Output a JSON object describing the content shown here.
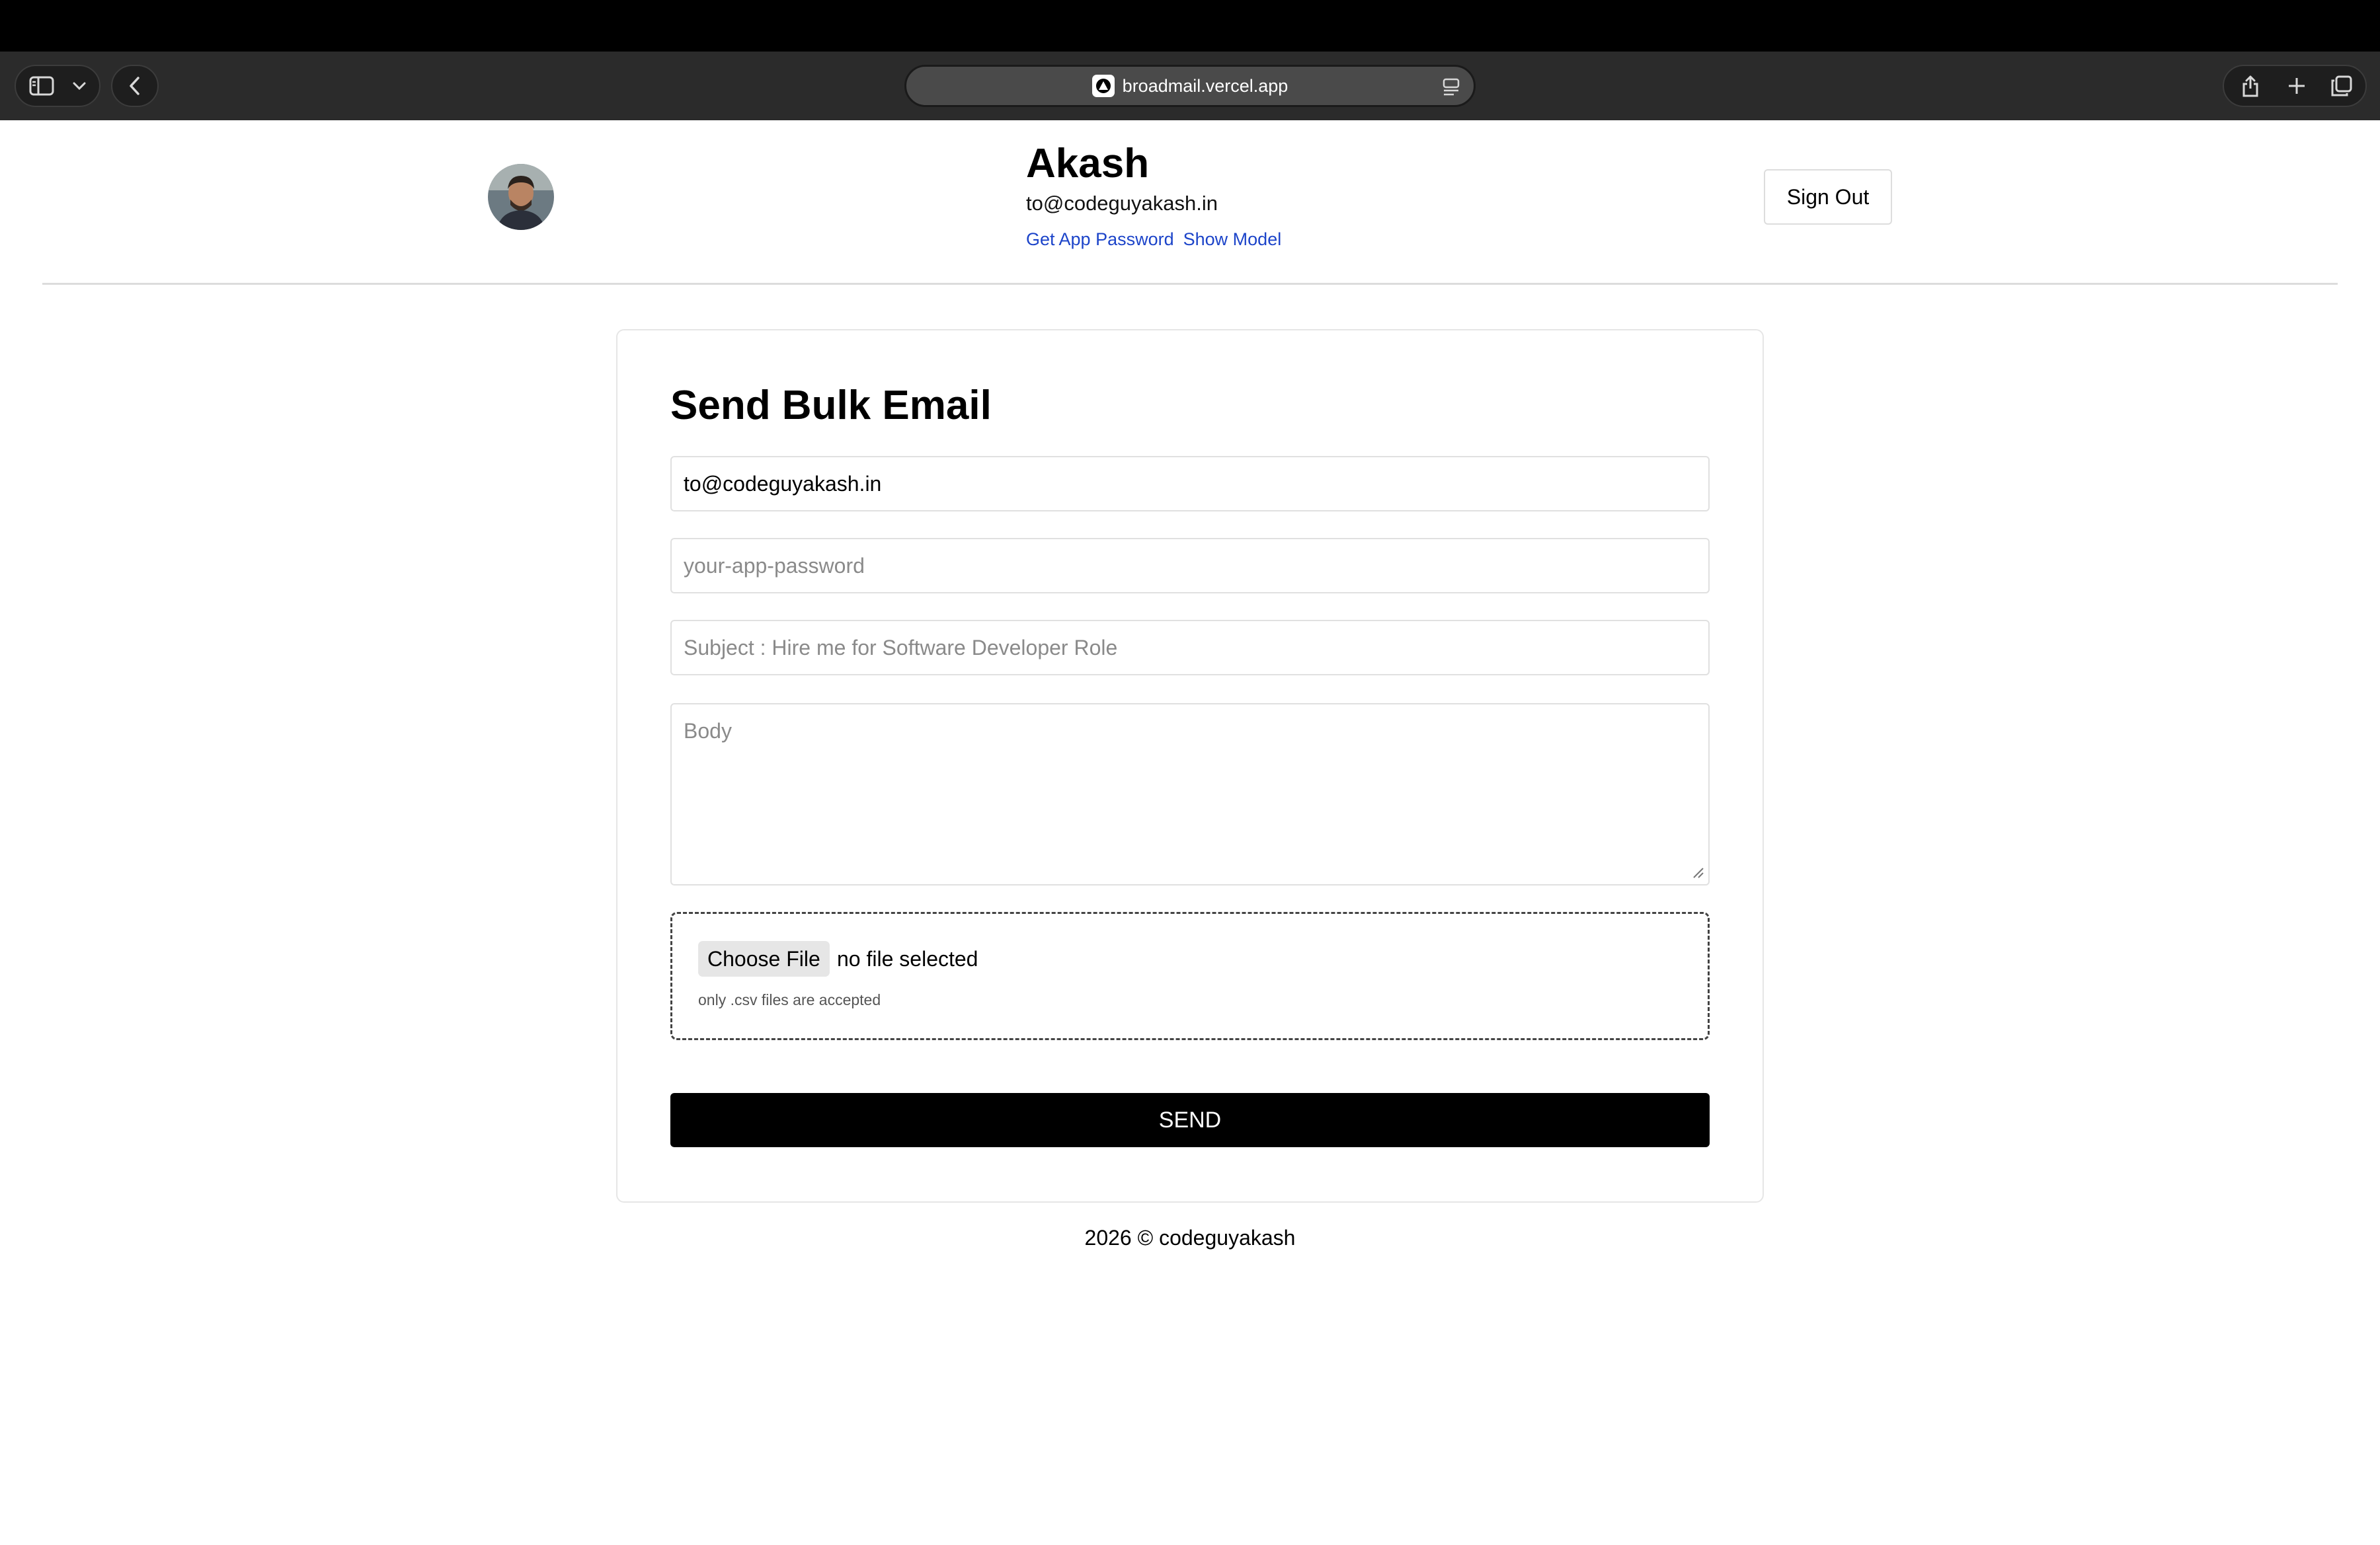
{
  "browser": {
    "url": "broadmail.vercel.app"
  },
  "header": {
    "user_name": "Akash",
    "user_email": "to@codeguyakash.in",
    "links": [
      "Get App Password",
      "Show Model"
    ],
    "sign_out_label": "Sign Out"
  },
  "form": {
    "title": "Send Bulk Email",
    "email_value": "to@codeguyakash.in",
    "password_placeholder": "your-app-password",
    "subject_placeholder": "Subject : Hire me for Software Developer Role",
    "body_placeholder": "Body",
    "file_button_label": "Choose File",
    "file_status": "no file selected",
    "file_hint": "only .csv files are accepted",
    "send_label": "SEND"
  },
  "footer": {
    "text": "2026 © codeguyakash"
  },
  "icons": {
    "sidebar": "sidebar-icon",
    "chevron": "chevron-down-icon",
    "back": "back-arrow-icon",
    "share": "share-icon",
    "new_tab": "plus-icon",
    "tabs": "tabs-overview-icon"
  }
}
